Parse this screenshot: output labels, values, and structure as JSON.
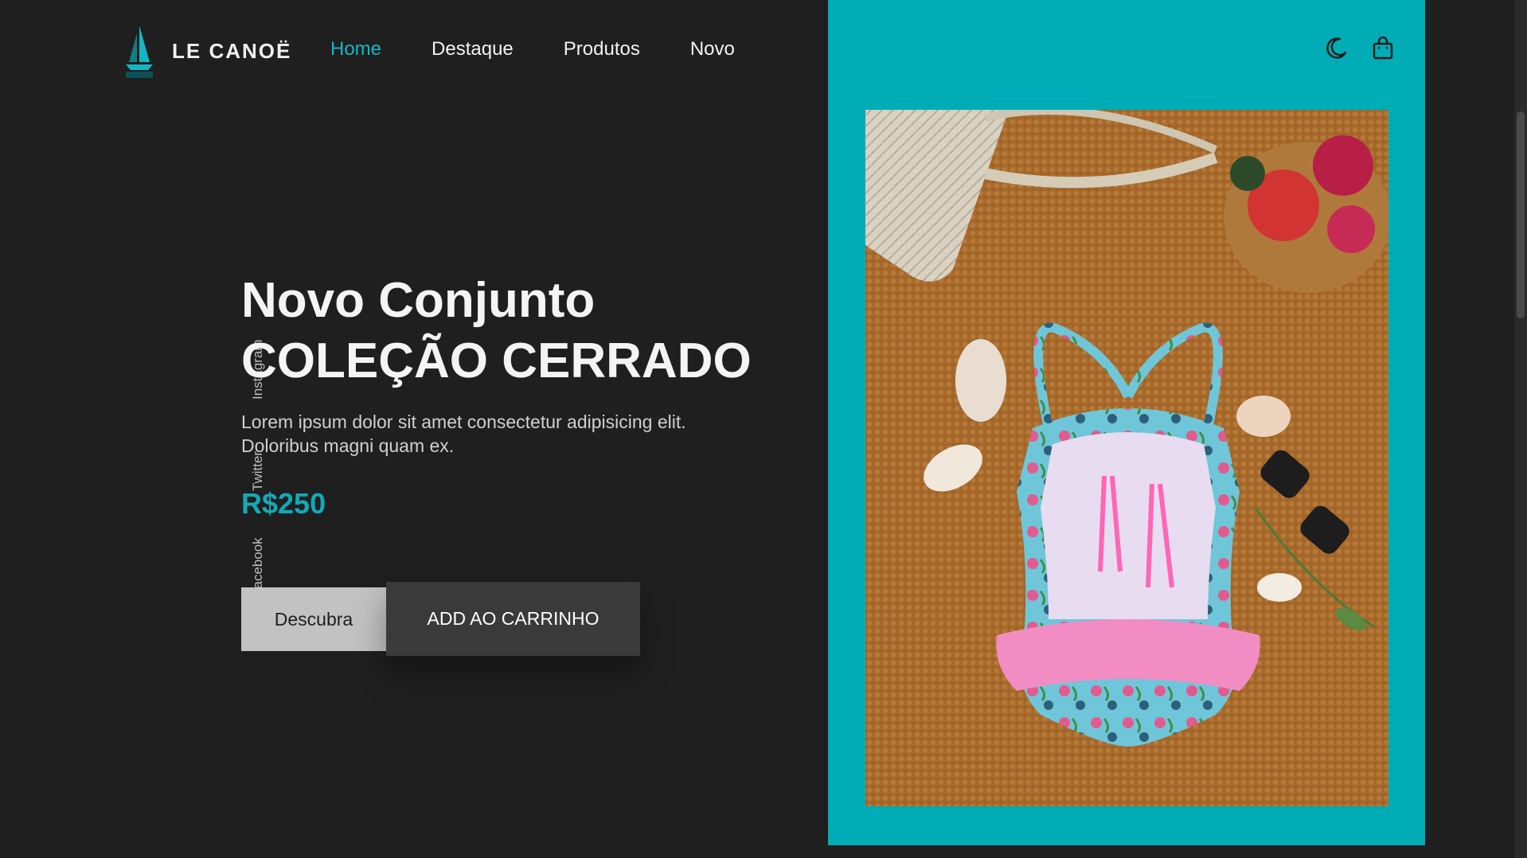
{
  "brand": {
    "name": "LE CANOË",
    "logo_icon": "sailboat-icon",
    "accent_color": "#14b8c4"
  },
  "nav": {
    "items": [
      {
        "label": "Home",
        "active": true
      },
      {
        "label": "Destaque",
        "active": false
      },
      {
        "label": "Produtos",
        "active": false
      },
      {
        "label": "Novo",
        "active": false
      }
    ]
  },
  "header_icons": [
    "moon-icon",
    "shopping-bag-icon"
  ],
  "social": {
    "instagram": "Instagram",
    "twitter": "Twitter",
    "facebook": "Facebook"
  },
  "hero": {
    "title_line1": "Novo Conjunto",
    "title_line2": "COLEÇÃO CERRADO",
    "description": "Lorem ipsum dolor sit amet consectetur adipisicing elit. Doloribus magni quam ex.",
    "price": "R$250",
    "discover_label": "Descubra",
    "cart_label": "ADD AO CARRINHO"
  },
  "colors": {
    "background": "#1f1f20",
    "panel": "#00acb5",
    "price": "#13aab6"
  }
}
